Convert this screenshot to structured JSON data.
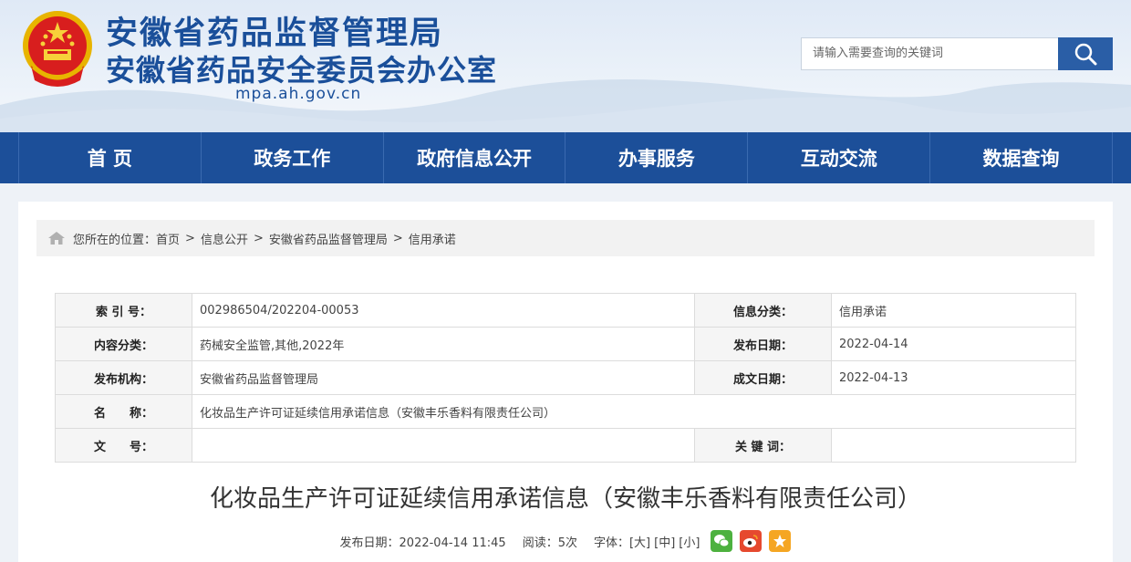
{
  "header": {
    "title_line1": "安徽省药品监督管理局",
    "title_line2": "安徽省药品安全委员会办公室",
    "domain": "mpa.ah.gov.cn",
    "search_placeholder": "请输入需要查询的关键词"
  },
  "nav": [
    {
      "label": "首 页"
    },
    {
      "label": "政务工作"
    },
    {
      "label": "政府信息公开"
    },
    {
      "label": "办事服务"
    },
    {
      "label": "互动交流"
    },
    {
      "label": "数据查询"
    }
  ],
  "breadcrumb": {
    "prefix": "您所在的位置：",
    "items": [
      "首页",
      "信息公开",
      "安徽省药品监督管理局",
      "信用承诺"
    ],
    "sep": ">"
  },
  "meta": {
    "index_label": "索 引 号：",
    "index_value": "002986504/202204-00053",
    "category_label": "信息分类：",
    "category_value": "信用承诺",
    "content_label": "内容分类：",
    "content_value": "药械安全监管,其他,2022年",
    "pubdate_label": "发布日期：",
    "pubdate_value": "2022-04-14",
    "org_label": "发布机构：",
    "org_value": "安徽省药品监督管理局",
    "created_label": "成文日期：",
    "created_value": "2022-04-13",
    "name_label": "名　　称：",
    "name_value": "化妆品生产许可证延续信用承诺信息（安徽丰乐香料有限责任公司）",
    "docno_label": "文　　号：",
    "docno_value": "",
    "keywords_label": "关 键 词：",
    "keywords_value": ""
  },
  "article": {
    "title": "化妆品生产许可证延续信用承诺信息（安徽丰乐香料有限责任公司）",
    "pubdate": "发布日期：2022-04-14 11:45",
    "reads": "阅读：5次",
    "font_label": "字体：",
    "font_large": "[大]",
    "font_medium": "[中]",
    "font_small": "[小]"
  },
  "colors": {
    "nav_bg": "#1c4f99",
    "title": "#1a4f9a",
    "wechat": "#4db13f",
    "weibo": "#e6492f",
    "favorite": "#f5a623"
  },
  "icons": [
    "emblem-icon",
    "search-icon",
    "home-icon",
    "wechat-icon",
    "weibo-icon",
    "star-icon"
  ]
}
